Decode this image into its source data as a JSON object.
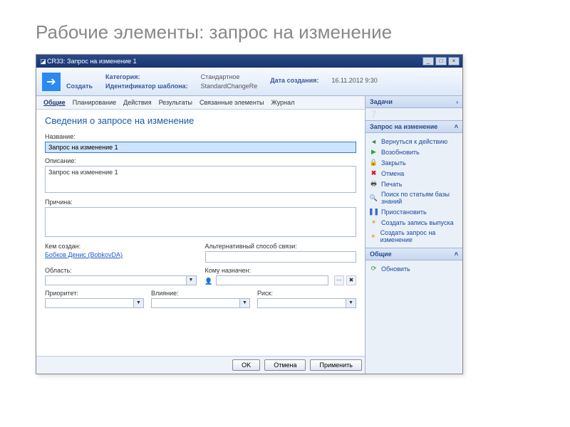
{
  "slide": {
    "title": "Рабочие элементы: запрос на изменение"
  },
  "window": {
    "title": "CR33: Запрос на изменение 1",
    "minimize": "_",
    "maximize": "□",
    "close": "×"
  },
  "ribbon": {
    "create": "Создать",
    "category_label": "Категория:",
    "category_value": "Стандартное",
    "template_label": "Идентификатор шаблона:",
    "template_value": "StandardChangeRe",
    "date_label": "Дата создания:",
    "date_value": "16.11.2012 9:30"
  },
  "tabs": [
    "Общие",
    "Планирование",
    "Действия",
    "Результаты",
    "Связанные элементы",
    "Журнал"
  ],
  "form": {
    "section_title": "Сведения о запросе на изменение",
    "name_label": "Название:",
    "name_value": "Запрос на изменение 1",
    "desc_label": "Описание:",
    "desc_value": "Запрос на изменение 1",
    "reason_label": "Причина:",
    "reason_value": "",
    "created_by_label": "Кем создан:",
    "created_by_value": "Бобков Денис (BobkovDA)",
    "alt_contact_label": "Альтернативный способ связи:",
    "alt_contact_value": "",
    "area_label": "Область:",
    "area_value": "",
    "assigned_label": "Кому назначен:",
    "assigned_value": "",
    "priority_label": "Приоритет:",
    "priority_value": "",
    "impact_label": "Влияние:",
    "impact_value": "",
    "risk_label": "Риск:",
    "risk_value": ""
  },
  "buttons": {
    "ok": "OK",
    "cancel": "Отмена",
    "apply": "Применить"
  },
  "sidebar": {
    "tasks_header": "Задачи",
    "group1_title": "Запрос на изменение",
    "group1_items": [
      {
        "icon": "back",
        "glyph": "◄",
        "label": "Вернуться к действию"
      },
      {
        "icon": "play",
        "glyph": "▶",
        "label": "Возобновить"
      },
      {
        "icon": "lock",
        "glyph": "🔒",
        "label": "Закрыть"
      },
      {
        "icon": "close",
        "glyph": "✖",
        "label": "Отмена"
      },
      {
        "icon": "print",
        "glyph": "🖶",
        "label": "Печать"
      },
      {
        "icon": "search",
        "glyph": "🔍",
        "label": "Поиск по статьям базы знаний"
      },
      {
        "icon": "pause",
        "glyph": "❚❚",
        "label": "Приостановить"
      },
      {
        "icon": "star",
        "glyph": "✶",
        "label": "Создать запись выпуска"
      },
      {
        "icon": "star",
        "glyph": "✶",
        "label": "Создать запрос на изменение"
      }
    ],
    "group2_title": "Общие",
    "group2_items": [
      {
        "icon": "refresh",
        "glyph": "⟳",
        "label": "Обновить"
      }
    ]
  }
}
